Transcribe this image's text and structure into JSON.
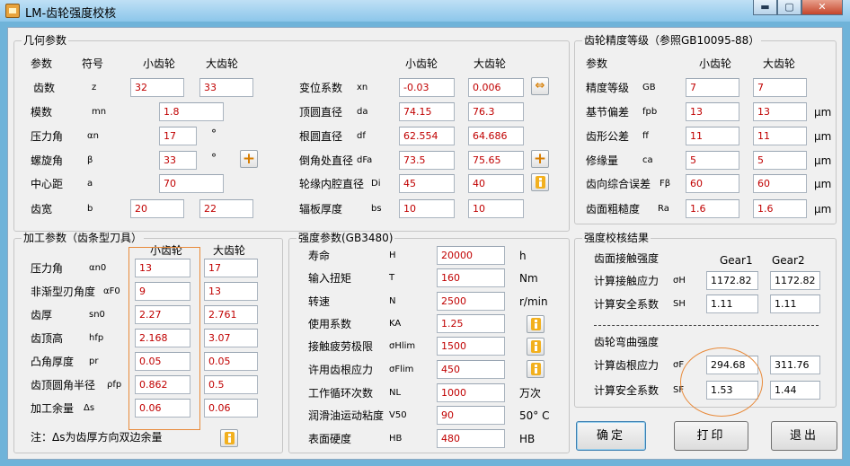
{
  "window": {
    "title": "LM-齿轮强度校核",
    "min": "▬",
    "max": "▢",
    "close": "✕"
  },
  "geom": {
    "title": "几何参数",
    "h_param": "参数",
    "h_symbol": "符号",
    "h_small": "小齿轮",
    "h_large": "大齿轮",
    "rows": [
      {
        "label": "齿数",
        "sym": "z",
        "v1": "32",
        "v2": "33"
      },
      {
        "label": "模数",
        "sym": "mn",
        "v1": "1.8"
      },
      {
        "label": "压力角",
        "sym": "αn",
        "v1": "17",
        "unit": "°"
      },
      {
        "label": "螺旋角",
        "sym": "β",
        "v1": "33",
        "unit": "°"
      },
      {
        "label": "中心距",
        "sym": "a",
        "v1": "70"
      },
      {
        "label": "齿宽",
        "sym": "b",
        "v1": "20",
        "v2": "22"
      }
    ],
    "h_small2": "小齿轮",
    "h_large2": "大齿轮",
    "rows2": [
      {
        "label": "变位系数",
        "sym": "xn",
        "v1": "-0.03",
        "v2": "0.006"
      },
      {
        "label": "顶圆直径",
        "sym": "da",
        "v1": "74.15",
        "v2": "76.3"
      },
      {
        "label": "根圆直径",
        "sym": "df",
        "v1": "62.554",
        "v2": "64.686"
      },
      {
        "label": "倒角处直径",
        "sym": "dFa",
        "v1": "73.5",
        "v2": "75.65"
      },
      {
        "label": "轮缘内腔直径",
        "sym": "Di",
        "v1": "45",
        "v2": "40"
      },
      {
        "label": "辐板厚度",
        "sym": "bs",
        "v1": "10",
        "v2": "10"
      }
    ]
  },
  "accuracy": {
    "title": "齿轮精度等级（参照GB10095-88）",
    "h_param": "参数",
    "h_small": "小齿轮",
    "h_large": "大齿轮",
    "rows": [
      {
        "label": "精度等级",
        "sym": "GB",
        "v1": "7",
        "v2": "7"
      },
      {
        "label": "基节偏差",
        "sym": "fpb",
        "v1": "13",
        "v2": "13",
        "unit": "μm"
      },
      {
        "label": "齿形公差",
        "sym": "ff",
        "v1": "11",
        "v2": "11",
        "unit": "μm"
      },
      {
        "label": "修缘量",
        "sym": "ca",
        "v1": "5",
        "v2": "5",
        "unit": "μm"
      },
      {
        "label": "齿向综合误差",
        "sym": "Fβ",
        "v1": "60",
        "v2": "60",
        "unit": "μm"
      },
      {
        "label": "齿面粗糙度",
        "sym": "Ra",
        "v1": "1.6",
        "v2": "1.6",
        "unit": "μm"
      }
    ]
  },
  "machining": {
    "title": "加工参数（齿条型刀具）",
    "h_small": "小齿轮",
    "h_large": "大齿轮",
    "rows": [
      {
        "label": "压力角",
        "sym": "αn0",
        "v1": "13",
        "v2": "17"
      },
      {
        "label": "非渐型刃角度",
        "sym": "αF0",
        "v1": "9",
        "v2": "13"
      },
      {
        "label": "齿厚",
        "sym": "sn0",
        "v1": "2.27",
        "v2": "2.761"
      },
      {
        "label": "齿顶高",
        "sym": "hfp",
        "v1": "2.168",
        "v2": "3.07"
      },
      {
        "label": "凸角厚度",
        "sym": "pr",
        "v1": "0.05",
        "v2": "0.05"
      },
      {
        "label": "齿顶圆角半径",
        "sym": "ρfp",
        "v1": "0.862",
        "v2": "0.5"
      },
      {
        "label": "加工余量",
        "sym": "Δs",
        "v1": "0.06",
        "v2": "0.06"
      }
    ],
    "note": "注：Δs为齿厚方向双边余量"
  },
  "strength": {
    "title": "强度参数(GB3480)",
    "rows": [
      {
        "label": "寿命",
        "sym": "H",
        "v": "20000",
        "unit": "h"
      },
      {
        "label": "输入扭矩",
        "sym": "T",
        "v": "160",
        "unit": "Nm"
      },
      {
        "label": "转速",
        "sym": "N",
        "v": "2500",
        "unit": "r/min"
      },
      {
        "label": "使用系数",
        "sym": "KA",
        "v": "1.25"
      },
      {
        "label": "接触疲劳极限",
        "sym": "σHlim",
        "v": "1500"
      },
      {
        "label": "许用齿根应力",
        "sym": "σFlim",
        "v": "450"
      },
      {
        "label": "工作循环次数",
        "sym": "NL",
        "v": "1000",
        "unit": "万次"
      },
      {
        "label": "润滑油运动粘度",
        "sym": "V50",
        "v": "90",
        "unit": "50° C"
      },
      {
        "label": "表面硬度",
        "sym": "HB",
        "v": "480",
        "unit": "HB"
      }
    ]
  },
  "results": {
    "title": "强度校核结果",
    "contact_title": "齿面接触强度",
    "gear1": "Gear1",
    "gear2": "Gear2",
    "contact_rows": [
      {
        "label": "计算接触应力",
        "sym": "σH",
        "v1": "1172.82",
        "v2": "1172.82"
      },
      {
        "label": "计算安全系数",
        "sym": "SH",
        "v1": "1.11",
        "v2": "1.11"
      }
    ],
    "bending_title": "齿轮弯曲强度",
    "bending_rows": [
      {
        "label": "计算齿根应力",
        "sym": "σF",
        "v1": "294.68",
        "v2": "311.76"
      },
      {
        "label": "计算安全系数",
        "sym": "SF",
        "v1": "1.53",
        "v2": "1.44"
      }
    ]
  },
  "buttons": {
    "ok": "确定",
    "print": "打印",
    "exit": "退出"
  }
}
